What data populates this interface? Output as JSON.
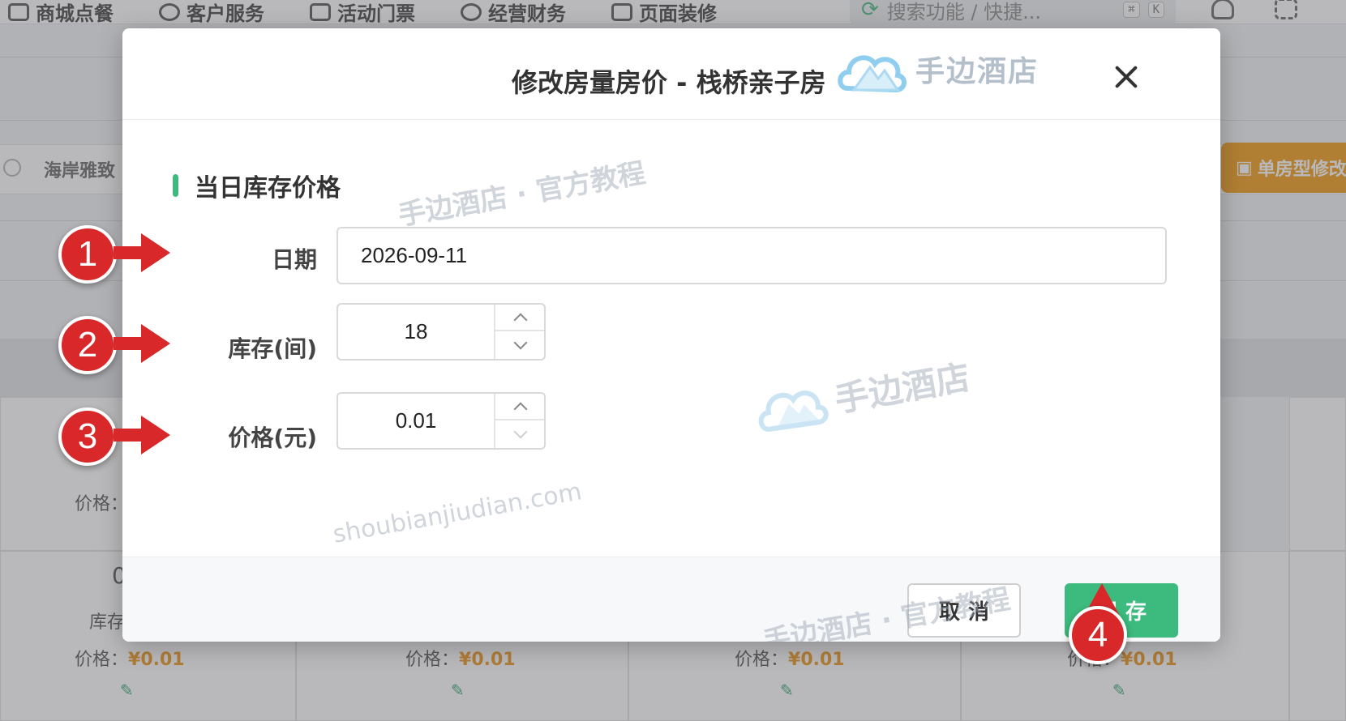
{
  "background": {
    "nav": [
      {
        "label": "商城点餐",
        "icon": "bag-icon"
      },
      {
        "label": "客户服务",
        "icon": "headset-icon"
      },
      {
        "label": "活动门票",
        "icon": "ticket-icon"
      },
      {
        "label": "经营财务",
        "icon": "chart-icon"
      },
      {
        "label": "页面装修",
        "icon": "brush-icon"
      }
    ],
    "search_placeholder": "搜索功能 / 快捷...",
    "shortcut_keys": [
      "⌘",
      "K"
    ],
    "hotel_name": "海岸雅致",
    "bulk_edit_button": "单房型修改",
    "cells": {
      "stock_label": "库存",
      "price_label": "价格：",
      "price_value": "¥0.01",
      "stock_digit": "0"
    }
  },
  "modal": {
    "title": "修改房量房价 - 栈桥亲子房",
    "brand_text": "手边酒店",
    "section_title": "当日库存价格",
    "fields": {
      "date": {
        "label": "日期",
        "value": "2026-09-11"
      },
      "stock": {
        "label": "库存(间)",
        "value": "18"
      },
      "price": {
        "label": "价格(元)",
        "value": "0.01"
      }
    },
    "buttons": {
      "cancel": "取消",
      "save": "保存"
    }
  },
  "watermarks": {
    "tutorial": "手边酒店 · 官方教程",
    "brand": "手边酒店",
    "domain": "shoubianjiudian.com"
  },
  "annotations": [
    "1",
    "2",
    "3",
    "4"
  ],
  "colors": {
    "accent_green": "#3dba7e",
    "badge_red": "#d8282a",
    "price_orange": "#f0a030",
    "bulk_button_orange": "#f3a42c"
  }
}
